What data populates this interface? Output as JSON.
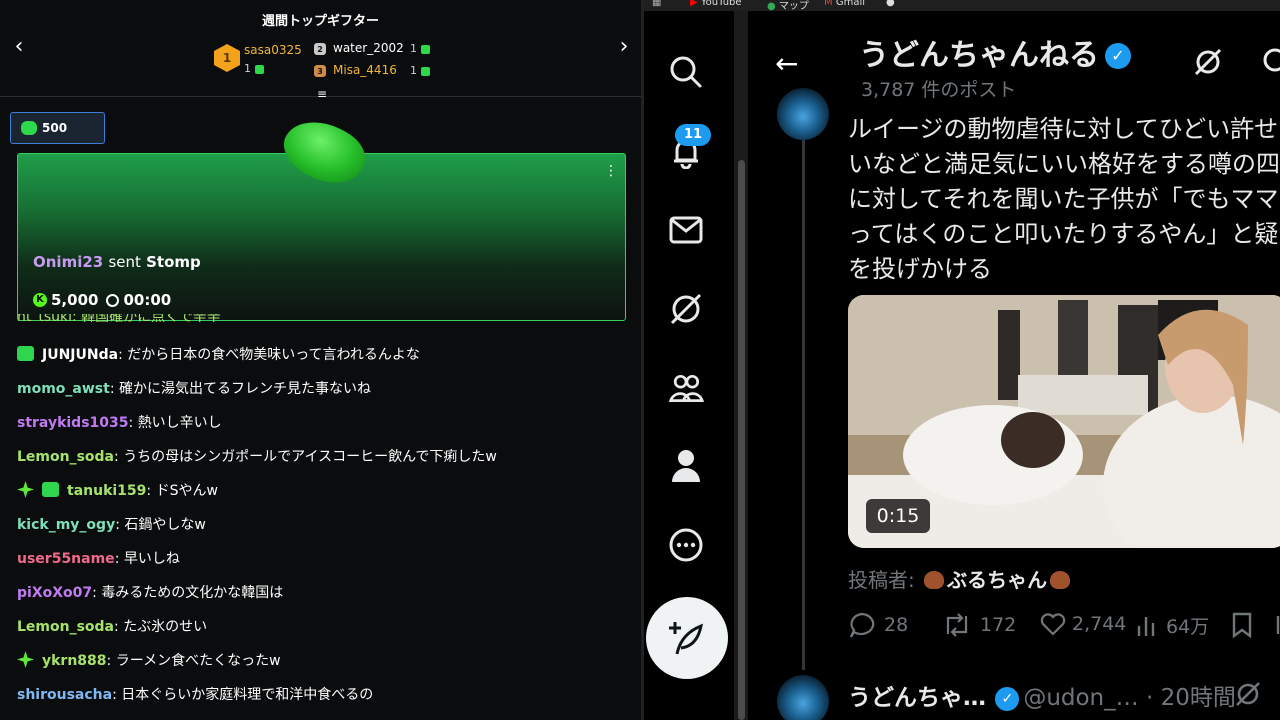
{
  "chat": {
    "gifters": {
      "title": "週間トップギフター",
      "first": {
        "rank": "1",
        "name": "sasa0325",
        "count": "1"
      },
      "second": {
        "name": "water_2002",
        "count": "1"
      },
      "third": {
        "name": "Misa_4416",
        "count": "1"
      }
    },
    "pinned_amount": "500",
    "gift_card": {
      "user": "Onimi23",
      "verb": "sent",
      "gift": "Stomp",
      "amount": "5,000",
      "time": "00:00"
    },
    "partial_line": "ht_tsuki: 韓国確かに点くで辛辛",
    "messages": [
      {
        "user": "JUNJUNda",
        "text": "だから日本の食べ物美味いって言われるんよな",
        "color": "#ffffff"
      },
      {
        "user": "momo_awst",
        "text": "確かに湯気出てるフレンチ見た事ないね",
        "color": "#7fe0b6"
      },
      {
        "user": "straykids1035",
        "text": "熱いし辛いし",
        "color": "#c07bf2"
      },
      {
        "user": "Lemon_soda",
        "text": "うちの母はシンガポールでアイスコーヒー飲んで下痢したw",
        "color": "#a6e36b"
      },
      {
        "user": "tanuki159",
        "text": "ドSやんw",
        "color": "#a6e36b"
      },
      {
        "user": "kick_my_ogy",
        "text": "石鍋やしなw",
        "color": "#7fe0b6"
      },
      {
        "user": "user55name",
        "text": "早いしね",
        "color": "#f06a8a"
      },
      {
        "user": "piXoXo07",
        "text": "毒みるための文化かな韓国は",
        "color": "#c07bf2"
      },
      {
        "user": "Lemon_soda",
        "text": "たぶ氷のせい",
        "color": "#a6e36b"
      },
      {
        "user": "ykrn888",
        "text": "ラーメン食べたくなったw",
        "color": "#a6e36b"
      },
      {
        "user": "shirousacha",
        "text": "日本ぐらいか家庭料理で和洋中食べるの",
        "color": "#7fb8f2"
      }
    ]
  },
  "bookmarks": {
    "youtube": "YouTube",
    "maps": "マップ",
    "gmail": "Gmail"
  },
  "x": {
    "notif_count": "11",
    "profile_name": "うどんちゃんねる",
    "post_count": "3,787 件のポスト",
    "post_lines": [
      "ルイージの動物虐待に対してひどい許せな",
      "いなどと満足気にいい格好をする噂の四季",
      "に対してそれを聞いた子供が「でもママだ",
      "ってはくのこと叩いたりするやん」と疑問",
      "を投げかける"
    ],
    "video_duration": "0:15",
    "poster_label": "投稿者:",
    "poster_name": "ぶるちゃん",
    "replies": "28",
    "reposts": "172",
    "likes": "2,744",
    "views": "64万",
    "next_post": {
      "name": "うどんちゃ…",
      "handle": "@udon_…",
      "time": "· 20時間"
    }
  }
}
